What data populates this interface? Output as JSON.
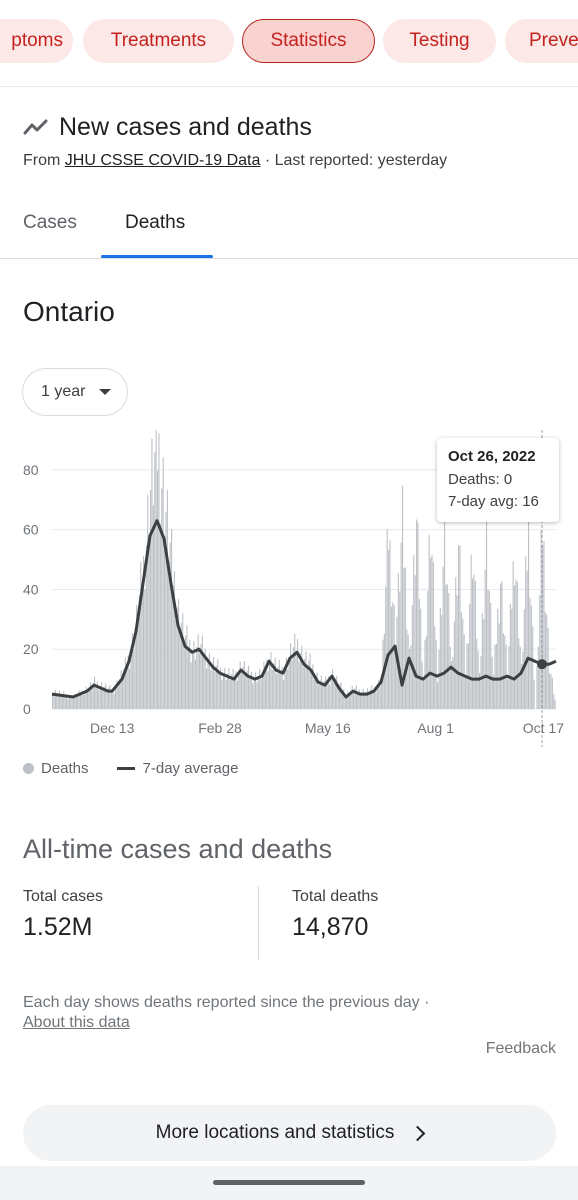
{
  "chips": [
    "ptoms",
    "Treatments",
    "Statistics",
    "Testing",
    "Preve"
  ],
  "card": {
    "title": "New cases and deaths",
    "source_prefix": "From ",
    "source_link": "JHU CSSE COVID-19 Data",
    "source_suffix": " · Last reported: yesterday"
  },
  "tabs": {
    "cases": "Cases",
    "deaths": "Deaths",
    "selected": "Deaths"
  },
  "region": "Ontario",
  "range": {
    "selected": "1 year"
  },
  "tooltip": {
    "date": "Oct 26, 2022",
    "deaths": "Deaths: 0",
    "avg": "7-day avg: 16"
  },
  "legend": {
    "deaths": "Deaths",
    "avg": "7-day average"
  },
  "colors": {
    "bars": "#bdc1c6",
    "avg_line": "#3c4043",
    "accent": "#1a73e8",
    "chip_text": "#c5221f"
  },
  "chart_data": {
    "type": "bar",
    "ylim": [
      0,
      90
    ],
    "y_ticks": [
      "0",
      "20",
      "40",
      "60",
      "80"
    ],
    "x_ticks": [
      "Dec 13",
      "Feb 28",
      "May 16",
      "Aug 1",
      "Oct 17"
    ],
    "x_tick_days": [
      43,
      120,
      197,
      274,
      351
    ],
    "x_range_days": [
      0,
      360
    ],
    "series": [
      {
        "name": "7-day average",
        "x_days": [
          0,
          15,
          25,
          30,
          35,
          40,
          43,
          50,
          55,
          60,
          65,
          70,
          75,
          80,
          85,
          90,
          95,
          100,
          105,
          110,
          115,
          120,
          125,
          130,
          135,
          140,
          145,
          150,
          155,
          160,
          165,
          170,
          175,
          180,
          185,
          190,
          195,
          200,
          205,
          210,
          215,
          220,
          225,
          230,
          235,
          240,
          245,
          250,
          255,
          260,
          265,
          270,
          275,
          280,
          285,
          290,
          295,
          300,
          305,
          310,
          315,
          320,
          325,
          330,
          335,
          340,
          345,
          350,
          355,
          360
        ],
        "values": [
          5,
          4,
          6,
          8,
          7,
          6,
          6,
          10,
          16,
          26,
          42,
          58,
          63,
          57,
          42,
          28,
          21,
          19,
          20,
          17,
          14,
          12,
          11,
          10,
          13,
          11,
          10,
          11,
          16,
          13,
          12,
          17,
          19,
          15,
          13,
          9,
          8,
          11,
          7,
          4,
          6,
          5,
          5,
          6,
          9,
          18,
          21,
          8,
          17,
          11,
          10,
          12,
          11,
          12,
          14,
          12,
          11,
          10,
          10,
          11,
          10,
          10,
          11,
          10,
          12,
          17,
          16,
          15,
          15,
          16
        ]
      },
      {
        "name": "Deaths",
        "x_days": [
          0,
          15,
          25,
          30,
          35,
          40,
          43,
          50,
          55,
          60,
          65,
          70,
          75,
          80,
          85,
          90,
          95,
          100,
          105,
          110,
          115,
          120,
          125,
          130,
          135,
          140,
          145,
          150,
          155,
          160,
          165,
          170,
          175,
          180,
          185,
          190,
          195,
          200,
          205,
          210,
          215,
          220,
          225,
          230,
          235,
          240,
          245,
          250,
          255,
          260,
          265,
          270,
          275,
          280,
          285,
          290,
          295,
          300,
          305,
          310,
          315,
          320,
          325,
          330,
          335,
          340,
          345,
          350,
          355,
          360
        ],
        "values": [
          6,
          4,
          7,
          9,
          8,
          7,
          6,
          12,
          18,
          30,
          48,
          75,
          90,
          72,
          50,
          33,
          24,
          20,
          22,
          18,
          15,
          13,
          12,
          11,
          15,
          12,
          11,
          12,
          18,
          14,
          13,
          19,
          22,
          17,
          15,
          10,
          9,
          12,
          8,
          5,
          7,
          6,
          6,
          7,
          10,
          60,
          24,
          62,
          18,
          62,
          11,
          60,
          12,
          58,
          15,
          56,
          12,
          55,
          10,
          60,
          11,
          45,
          12,
          55,
          13,
          62,
          0,
          62,
          15,
          0
        ]
      }
    ]
  },
  "all_time": {
    "title": "All-time cases and deaths",
    "total_cases_label": "Total cases",
    "total_cases_value": "1.52M",
    "total_deaths_label": "Total deaths",
    "total_deaths_value": "14,870"
  },
  "footnote": {
    "text": "Each day shows deaths reported since the previous day  ·",
    "link": "About this data"
  },
  "feedback": "Feedback",
  "more_button": "More locations and statistics"
}
